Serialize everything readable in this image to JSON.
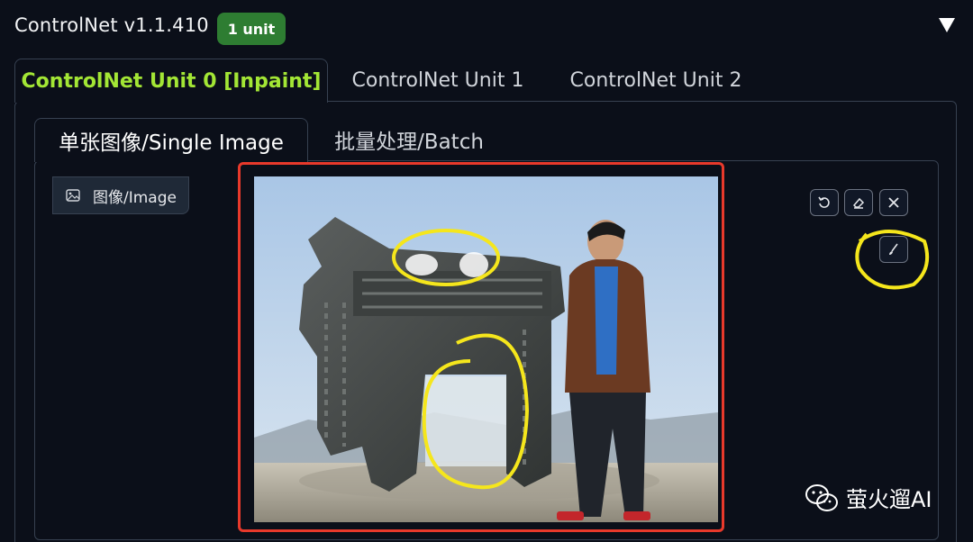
{
  "header": {
    "title": "ControlNet v1.1.410",
    "badge": "1 unit"
  },
  "unit_tabs": [
    {
      "label": "ControlNet Unit 0 [Inpaint]",
      "active": true
    },
    {
      "label": "ControlNet Unit 1",
      "active": false
    },
    {
      "label": "ControlNet Unit 2",
      "active": false
    }
  ],
  "sub_tabs": [
    {
      "label": "单张图像/Single Image",
      "active": true
    },
    {
      "label": "批量处理/Batch",
      "active": false
    }
  ],
  "image_panel": {
    "label": "图像/Image",
    "tools": [
      "undo-icon",
      "eraser-icon",
      "close-icon",
      "brush-icon"
    ]
  },
  "watermark": {
    "text": "萤火遛AI"
  },
  "colors": {
    "background": "#0b0f19",
    "active_tab": "#a3e635",
    "badge": "#2e7d32",
    "frame_highlight": "#e8392b",
    "annotation": "#f5e61c"
  }
}
